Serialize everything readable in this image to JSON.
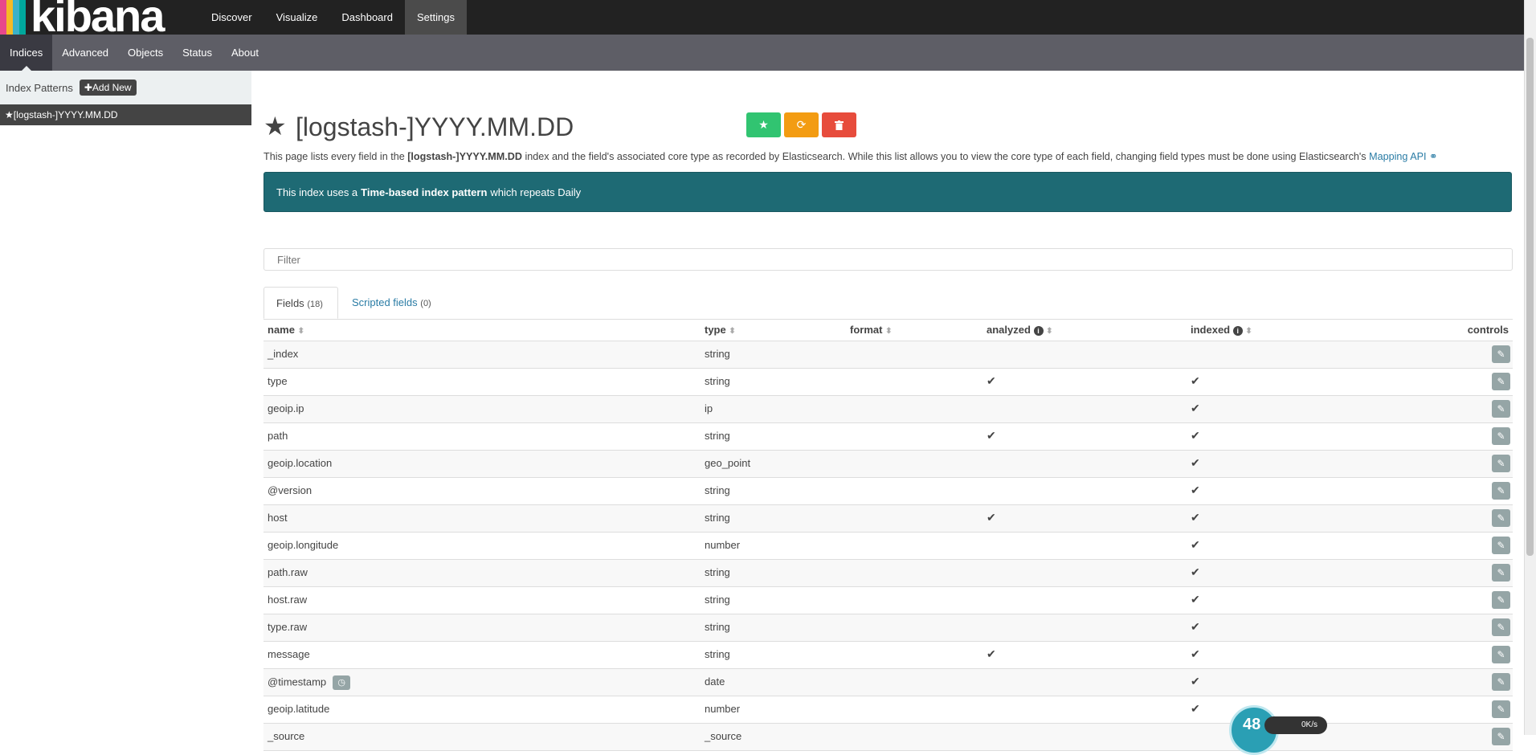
{
  "app": {
    "logo_text": "kibana"
  },
  "topnav": {
    "items": [
      {
        "label": "Discover"
      },
      {
        "label": "Visualize"
      },
      {
        "label": "Dashboard"
      },
      {
        "label": "Settings"
      }
    ]
  },
  "subnav": {
    "items": [
      {
        "label": "Indices"
      },
      {
        "label": "Advanced"
      },
      {
        "label": "Objects"
      },
      {
        "label": "Status"
      },
      {
        "label": "About"
      }
    ]
  },
  "sidebar": {
    "title": "Index Patterns",
    "add_new_label": "Add New",
    "patterns": [
      {
        "label": "[logstash-]YYYY.MM.DD"
      }
    ]
  },
  "main": {
    "title": "[logstash-]YYYY.MM.DD",
    "description_pre": "This page lists every field in the ",
    "description_bold": "[logstash-]YYYY.MM.DD",
    "description_post": " index and the field's associated core type as recorded by Elasticsearch. While this list allows you to view the core type of each field, changing field types must be done using Elasticsearch's ",
    "mapping_link": "Mapping API",
    "alert_pre": "This index uses a ",
    "alert_bold": "Time-based index pattern",
    "alert_post": " which repeats Daily",
    "filter_placeholder": "Filter",
    "tabs": [
      {
        "label": "Fields",
        "count": "(18)"
      },
      {
        "label": "Scripted fields",
        "count": "(0)"
      }
    ],
    "table": {
      "headers": {
        "name": "name",
        "type": "type",
        "format": "format",
        "analyzed": "analyzed",
        "indexed": "indexed",
        "controls": "controls"
      },
      "rows": [
        {
          "name": "_index",
          "type": "string",
          "analyzed": false,
          "indexed": false
        },
        {
          "name": "type",
          "type": "string",
          "analyzed": true,
          "indexed": true
        },
        {
          "name": "geoip.ip",
          "type": "ip",
          "analyzed": false,
          "indexed": true
        },
        {
          "name": "path",
          "type": "string",
          "analyzed": true,
          "indexed": true
        },
        {
          "name": "geoip.location",
          "type": "geo_point",
          "analyzed": false,
          "indexed": true
        },
        {
          "name": "@version",
          "type": "string",
          "analyzed": false,
          "indexed": true
        },
        {
          "name": "host",
          "type": "string",
          "analyzed": true,
          "indexed": true
        },
        {
          "name": "geoip.longitude",
          "type": "number",
          "analyzed": false,
          "indexed": true
        },
        {
          "name": "path.raw",
          "type": "string",
          "analyzed": false,
          "indexed": true
        },
        {
          "name": "host.raw",
          "type": "string",
          "analyzed": false,
          "indexed": true
        },
        {
          "name": "type.raw",
          "type": "string",
          "analyzed": false,
          "indexed": true
        },
        {
          "name": "message",
          "type": "string",
          "analyzed": true,
          "indexed": true
        },
        {
          "name": "@timestamp",
          "type": "date",
          "analyzed": false,
          "indexed": true,
          "time_field": true
        },
        {
          "name": "geoip.latitude",
          "type": "number",
          "analyzed": false,
          "indexed": true
        },
        {
          "name": "_source",
          "type": "_source",
          "analyzed": false,
          "indexed": false
        }
      ]
    }
  },
  "widget": {
    "percent": "48",
    "speed": "0K/s"
  },
  "colors": {
    "topbar": "#222222",
    "subnav": "#5e5e66",
    "alert": "#1e6a74",
    "link": "#2a7ca5",
    "btn_green": "#31c471",
    "btn_orange": "#f39c12",
    "btn_red": "#e74c3c"
  }
}
